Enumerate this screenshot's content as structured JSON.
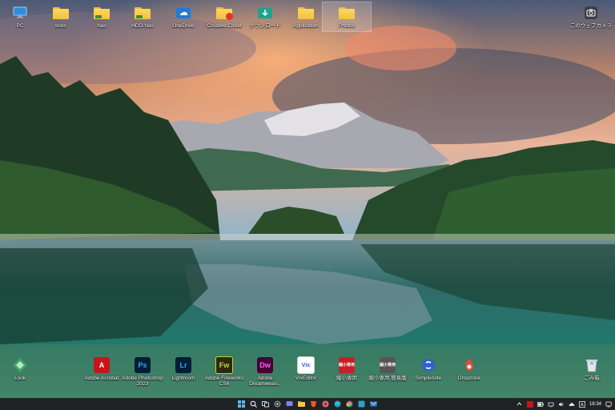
{
  "desktop": {
    "top_icons": [
      {
        "label": "PC",
        "icon": "monitor-icon"
      },
      {
        "label": "tools",
        "icon": "folder-icon"
      },
      {
        "label": "Nas",
        "icon": "folder-nas-icon"
      },
      {
        "label": "HDD-Nas",
        "icon": "folder-nas-icon"
      },
      {
        "label": "OneDrive",
        "icon": "onedrive-folder-icon"
      },
      {
        "label": "Creative Cloud",
        "icon": "creative-cloud-folder-icon"
      },
      {
        "label": "ダウンロード",
        "icon": "downloads-folder-icon"
      },
      {
        "label": "Application",
        "icon": "folder-icon"
      },
      {
        "label": "Photos",
        "icon": "folder-icon"
      }
    ],
    "right_icon": {
      "label": "このウェブカメラ",
      "icon": "camera-icon"
    },
    "bottom_icons": [
      {
        "label": "Look",
        "icon": "look-app-icon"
      },
      {
        "label": "Adobe Acrobat",
        "icon": "acrobat-icon",
        "tile_text": "A",
        "color": "#c8141a"
      },
      {
        "label": "Adobe Photoshop 2023",
        "icon": "photoshop-icon",
        "tile_text": "Ps",
        "color": "#31a8ff"
      },
      {
        "label": "Lightroom",
        "icon": "lightroom-icon",
        "tile_text": "Lr",
        "color": "#31a8ff"
      },
      {
        "label": "Adobe Fireworks CS6",
        "icon": "fireworks-icon",
        "tile_text": "Fw",
        "color": "#cbd42b"
      },
      {
        "label": "Adobe Dreamweav...",
        "icon": "dreamweaver-icon",
        "tile_text": "Dw",
        "color": "#ff61f6"
      },
      {
        "label": "VixEditor",
        "icon": "vixeditor-icon",
        "tile_text": "Vix",
        "color": "#2b5fd1"
      },
      {
        "label": "縮小専用",
        "icon": "shukusen-icon",
        "tile_text": "縮小専用",
        "color": "#c81e28"
      },
      {
        "label": "縮小専用 簡易版",
        "icon": "shukusen-lite-icon",
        "tile_text": "縮小専用",
        "color": "#555555"
      },
      {
        "label": "Simplenote",
        "icon": "simplenote-icon",
        "tile_text": "S",
        "color": "#3361cc"
      },
      {
        "label": "Dropzone",
        "icon": "dropzone-icon",
        "tile_text": "",
        "color": "#e04b3c"
      }
    ],
    "recycle_bin": {
      "label": "ごみ箱",
      "icon": "recycle-bin-icon"
    }
  },
  "taskbar": {
    "items": [
      {
        "name": "start-icon"
      },
      {
        "name": "search-icon"
      },
      {
        "name": "task-view-icon"
      },
      {
        "name": "settings-icon"
      },
      {
        "name": "chat-icon"
      },
      {
        "name": "file-explorer-icon"
      },
      {
        "name": "brave-browser-icon"
      },
      {
        "name": "firefox-icon"
      },
      {
        "name": "edge-icon"
      },
      {
        "name": "chrome-icon"
      },
      {
        "name": "app-icon"
      },
      {
        "name": "mail-icon"
      }
    ],
    "tray": {
      "clock": "18:34",
      "items": [
        "chevron-up-icon",
        "acrobat-tray-icon",
        "battery-icon",
        "network-icon",
        "volume-icon",
        "onedrive-tray-icon",
        "ime-icon"
      ]
    }
  },
  "colors": {
    "taskbar": "#1f2326",
    "label_text": "#ffffff",
    "folder": "#f2c13f"
  }
}
